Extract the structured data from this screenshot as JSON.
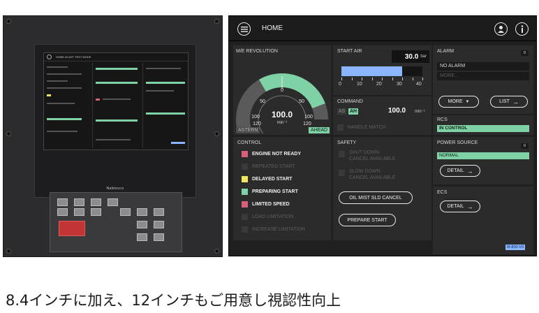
{
  "header": {
    "title": "HOME"
  },
  "revolution": {
    "title": "M/E REVOLUTION",
    "ticks": [
      "0",
      "50",
      "50",
      "100",
      "100",
      "120",
      "120"
    ],
    "value": "100.0",
    "unit": "min⁻¹",
    "astern": "ASTERN",
    "ahead": "AHEAD",
    "level": 0.83
  },
  "start_air": {
    "title": "START AIR",
    "value": "30.0",
    "unit": "bar",
    "axis": [
      "0",
      "10",
      "20",
      "30",
      "40"
    ],
    "level": 0.75
  },
  "command": {
    "title": "COMMAND",
    "as": "AS",
    "ah": "AH",
    "value": "100.0",
    "unit": "min⁻¹",
    "handle_match": "HANDLE MATCH"
  },
  "alarm": {
    "title": "ALARM",
    "count": "0",
    "status": "NO ALARM",
    "more_text": "MORE...",
    "more_btn": "MORE",
    "list_btn": "LIST"
  },
  "rcs": {
    "title": "RCS",
    "status": "IN CONTROL"
  },
  "control": {
    "title": "CONTROL",
    "items": [
      {
        "label": "ENGINE NOT READY",
        "color": "#d9607a",
        "active": true
      },
      {
        "label": "REPEATED START",
        "color": "#3a3a3a",
        "active": false
      },
      {
        "label": "DELAYED START",
        "color": "#f2e45c",
        "active": true
      },
      {
        "label": "PREPARING START",
        "color": "#7fd1a6",
        "active": true
      },
      {
        "label": "LIMITED SPEED",
        "color": "#d9607a",
        "active": true
      },
      {
        "label": "LOAD LIMITATION",
        "color": "#3a3a3a",
        "active": false
      },
      {
        "label": "INCREASE LIMITATION",
        "color": "#3a3a3a",
        "active": false
      }
    ]
  },
  "safety": {
    "title": "SAFETY",
    "shut_down": [
      "SHUT DOWN",
      "CANCEL AVAILABLE"
    ],
    "slow_down": [
      "SLOW DOWN",
      "CANCEL AVAILABLE"
    ],
    "oil_mist": "OIL MIST SLD CANCEL",
    "prepare": "PREPARE START"
  },
  "power_source": {
    "title": "POWER SOURCE",
    "count": "0",
    "status": "NORMAL",
    "detail": "DETAIL"
  },
  "ecs": {
    "title": "ECS",
    "detail": "DETAIL"
  },
  "model": "M-800-VII",
  "photo": {
    "brand": "Nabtesco",
    "mini_tabs": "HOME   ACAST   TEST MODE",
    "mini_labels": [
      "BRIDGE HANDLE",
      "ECR HANDLE",
      "HANDLE MATCH",
      "COMMAND",
      "POWER SOURCE",
      "ALL CAUSE RESET",
      "RCS",
      "MONITOR",
      "CONTROL",
      "LIMITED SPEED",
      "BRIDGE CONT. CONDITION",
      "OIL MIST SLD CANCEL",
      "SAFETY",
      "SHUT DOWN",
      "SLOW DOWN",
      "DETAIL",
      "DETAIL",
      "LOG"
    ]
  },
  "caption": "8.4インチに加え、12インチもご用意し視認性向上"
}
